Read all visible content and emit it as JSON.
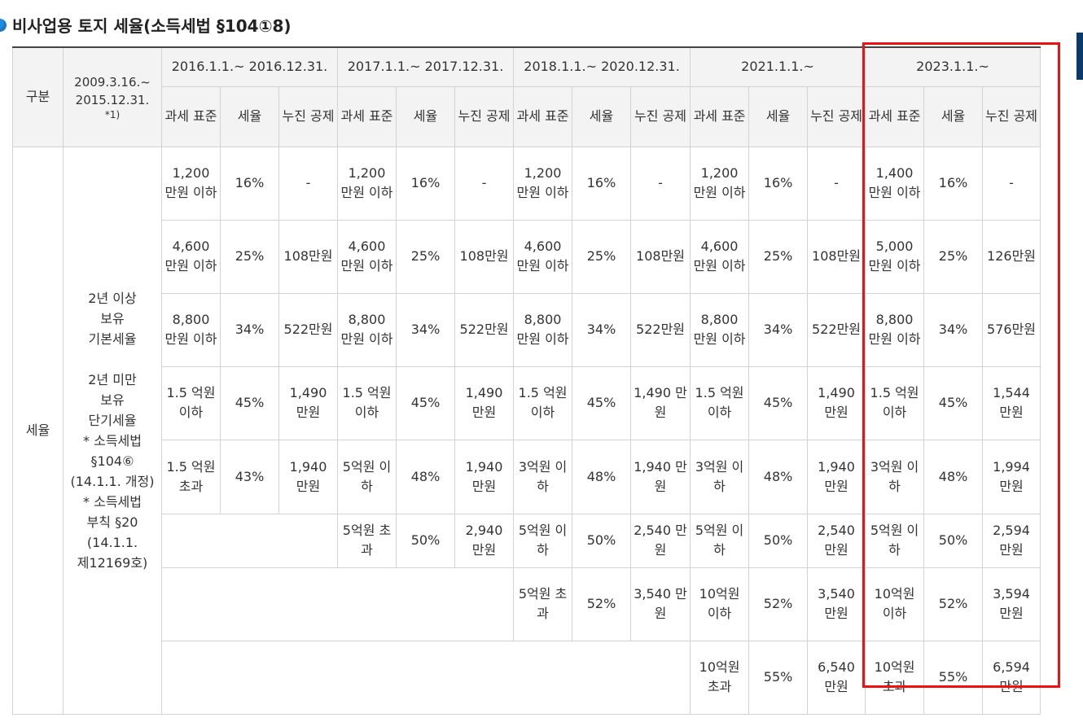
{
  "page_title": "비사업용 토지 세율(소득세법 §104①8)",
  "colors": {
    "accent": "#1e8ae0",
    "highlight_box": "#ee1111",
    "header_bg": "#f3f3f3"
  },
  "header": {
    "category": "구분",
    "early_period": {
      "line1": "2009.3.16.~",
      "line2": "2015.12.31.",
      "note": "*1)"
    },
    "periods": [
      "2016.1.1.~ 2016.12.31.",
      "2017.1.1.~ 2017.12.31.",
      "2018.1.1.~ 2020.12.31.",
      "2021.1.1.~",
      "2023.1.1.~"
    ],
    "sub": {
      "base": "과세 표준",
      "rate": "세율",
      "deduction": "누진 공제"
    }
  },
  "row_label": "세율",
  "category_lines": [
    "2년 이상",
    "보유",
    "기본세율",
    "",
    "2년 미만",
    "보유",
    "단기세율",
    "* 소득세법",
    "§104⑥",
    "(14.1.1. 개정)",
    "* 소득세법",
    "부칙 §20",
    "(14.1.1.",
    "제12169호)"
  ],
  "brackets": [
    [
      [
        "1,200 만원 이하",
        "16%",
        "-"
      ],
      [
        "1,200 만원 이하",
        "16%",
        "-"
      ],
      [
        "1,200 만원 이하",
        "16%",
        "-"
      ],
      [
        "1,200 만원 이하",
        "16%",
        "-"
      ],
      [
        "1,400 만원 이하",
        "16%",
        "-"
      ]
    ],
    [
      [
        "4,600 만원 이하",
        "25%",
        "108만원"
      ],
      [
        "4,600 만원 이하",
        "25%",
        "108만원"
      ],
      [
        "4,600 만원 이하",
        "25%",
        "108만원"
      ],
      [
        "4,600 만원 이하",
        "25%",
        "108만원"
      ],
      [
        "5,000 만원 이하",
        "25%",
        "126만원"
      ]
    ],
    [
      [
        "8,800 만원 이하",
        "34%",
        "522만원"
      ],
      [
        "8,800 만원 이하",
        "34%",
        "522만원"
      ],
      [
        "8,800 만원 이하",
        "34%",
        "522만원"
      ],
      [
        "8,800 만원 이하",
        "34%",
        "522만원"
      ],
      [
        "8,800 만원 이하",
        "34%",
        "576만원"
      ]
    ],
    [
      [
        "1.5 억원 이하",
        "45%",
        "1,490 만원"
      ],
      [
        "1.5 억원 이하",
        "45%",
        "1,490 만원"
      ],
      [
        "1.5 억원 이하",
        "45%",
        "1,490 만원"
      ],
      [
        "1.5 억원 이하",
        "45%",
        "1,490 만원"
      ],
      [
        "1.5 억원 이하",
        "45%",
        "1,544 만원"
      ]
    ],
    [
      [
        "1.5 억원 초과",
        "43%",
        "1,940 만원"
      ],
      [
        "5억원 이하",
        "48%",
        "1,940 만원"
      ],
      [
        "3억원 이하",
        "48%",
        "1,940 만원"
      ],
      [
        "3억원 이하",
        "48%",
        "1,940 만원"
      ],
      [
        "3억원 이하",
        "48%",
        "1,994 만원"
      ]
    ],
    [
      null,
      [
        "5억원 초과",
        "50%",
        "2,940 만원"
      ],
      [
        "5억원 이하",
        "50%",
        "2,540 만원"
      ],
      [
        "5억원 이하",
        "50%",
        "2,540 만원"
      ],
      [
        "5억원 이하",
        "50%",
        "2,594 만원"
      ]
    ],
    [
      null,
      null,
      [
        "5억원 초과",
        "52%",
        "3,540 만원"
      ],
      [
        "10억원 이하",
        "52%",
        "3,540 만원"
      ],
      [
        "10억원 이하",
        "52%",
        "3,594 만원"
      ]
    ],
    [
      null,
      null,
      null,
      [
        "10억원 초과",
        "55%",
        "6,540 만원"
      ],
      [
        "10억원 초과",
        "55%",
        "6,594 만원"
      ]
    ]
  ]
}
